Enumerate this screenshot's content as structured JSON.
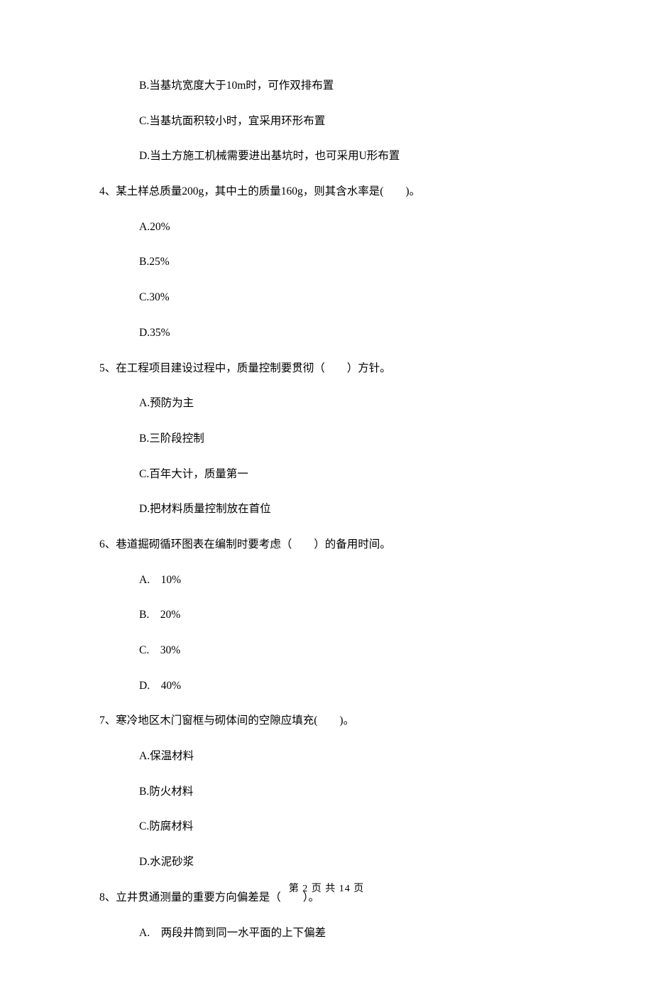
{
  "q3_trailing_options": {
    "b": "B.当基坑宽度大于10m时，可作双排布置",
    "c": "C.当基坑面积较小时，宜采用环形布置",
    "d": "D.当土方施工机械需要进出基坑时，也可采用U形布置"
  },
  "q4": {
    "stem": "4、某土样总质量200g，其中土的质量160g，则其含水率是(　　)。",
    "a": "A.20%",
    "b": "B.25%",
    "c": "C.30%",
    "d": "D.35%"
  },
  "q5": {
    "stem": "5、在工程项目建设过程中，质量控制要贯彻（　　）方针。",
    "a": "A.预防为主",
    "b": "B.三阶段控制",
    "c": "C.百年大计，质量第一",
    "d": "D.把材料质量控制放在首位"
  },
  "q6": {
    "stem": "6、巷道掘砌循环图表在编制时要考虑（　　）的备用时间。",
    "a": "A.　10%",
    "b": "B.　20%",
    "c": "C.　30%",
    "d": "D.　40%"
  },
  "q7": {
    "stem": "7、寒冷地区木门窗框与砌体间的空隙应填充(　　)。",
    "a": "A.保温材料",
    "b": "B.防火材料",
    "c": "C.防腐材料",
    "d": "D.水泥砂浆"
  },
  "q8": {
    "stem": "8、立井贯通测量的重要方向偏差是（　　）。",
    "a": "A.　两段井筒到同一水平面的上下偏差"
  },
  "footer": "第 2 页 共 14 页"
}
